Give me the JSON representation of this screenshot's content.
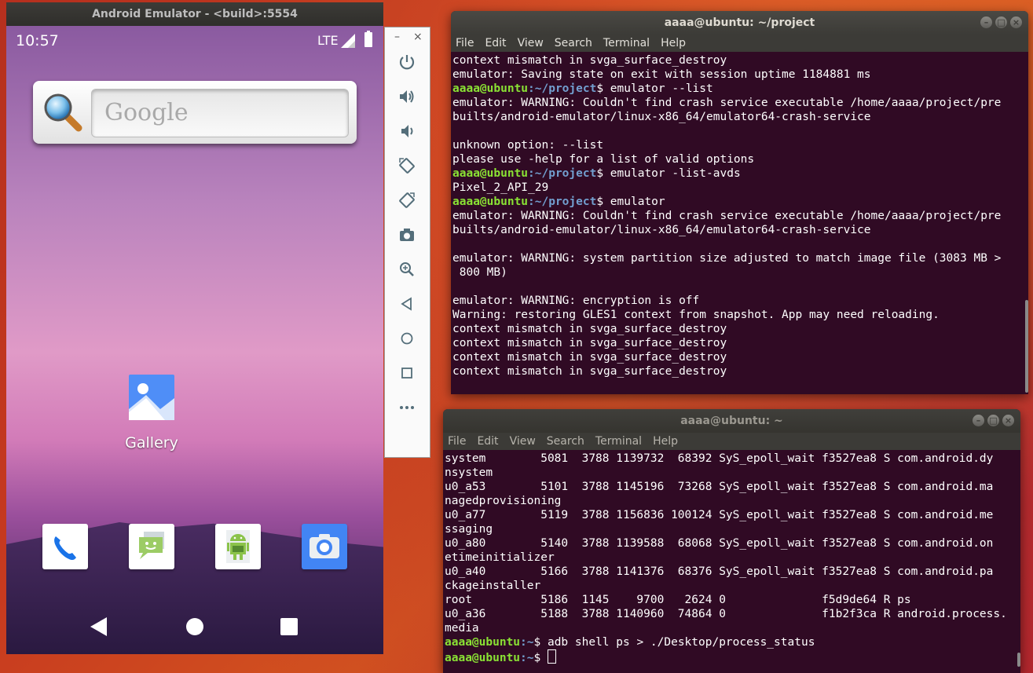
{
  "emulator": {
    "title": "Android Emulator - <build>:5554",
    "status": {
      "time": "10:57",
      "network": "LTE"
    },
    "search_widget": {
      "placeholder_text": "Google"
    },
    "home_apps": [
      {
        "label": "Gallery",
        "icon": "gallery-icon"
      }
    ],
    "dock": [
      {
        "name": "phone",
        "icon": "phone-icon"
      },
      {
        "name": "messages",
        "icon": "messages-icon"
      },
      {
        "name": "android-app",
        "icon": "android-robot-icon"
      },
      {
        "name": "camera",
        "icon": "camera-icon"
      }
    ],
    "toolbar": {
      "minimize_label": "–",
      "close_label": "×",
      "buttons": [
        "power-icon",
        "volume-up-icon",
        "volume-down-icon",
        "rotate-left-icon",
        "rotate-right-icon",
        "screenshot-icon",
        "zoom-icon",
        "back-icon",
        "home-icon",
        "overview-icon",
        "more-icon"
      ]
    }
  },
  "terminal_1": {
    "title": "aaaa@ubuntu: ~/project",
    "menu": [
      "File",
      "Edit",
      "View",
      "Search",
      "Terminal",
      "Help"
    ],
    "prompt_user": "aaaa@ubuntu",
    "prompt_path": ":~/project",
    "lines": [
      {
        "text": "context mismatch in svga_surface_destroy"
      },
      {
        "text": "emulator: Saving state on exit with session uptime 1184881 ms"
      },
      {
        "prompt": true,
        "cmd": "$ emulator --list"
      },
      {
        "text": "emulator: WARNING: Couldn't find crash service executable /home/aaaa/project/pre"
      },
      {
        "text": "builts/android-emulator/linux-x86_64/emulator64-crash-service"
      },
      {
        "text": ""
      },
      {
        "text": "unknown option: --list"
      },
      {
        "text": "please use -help for a list of valid options"
      },
      {
        "prompt": true,
        "cmd": "$ emulator -list-avds"
      },
      {
        "text": "Pixel_2_API_29"
      },
      {
        "prompt": true,
        "cmd": "$ emulator"
      },
      {
        "text": "emulator: WARNING: Couldn't find crash service executable /home/aaaa/project/pre"
      },
      {
        "text": "builts/android-emulator/linux-x86_64/emulator64-crash-service"
      },
      {
        "text": ""
      },
      {
        "text": "emulator: WARNING: system partition size adjusted to match image file (3083 MB >"
      },
      {
        "text": " 800 MB)"
      },
      {
        "text": ""
      },
      {
        "text": "emulator: WARNING: encryption is off"
      },
      {
        "text": "Warning: restoring GLES1 context from snapshot. App may need reloading."
      },
      {
        "text": "context mismatch in svga_surface_destroy"
      },
      {
        "text": "context mismatch in svga_surface_destroy"
      },
      {
        "text": "context mismatch in svga_surface_destroy"
      },
      {
        "text": "context mismatch in svga_surface_destroy"
      }
    ]
  },
  "terminal_2": {
    "title": "aaaa@ubuntu: ~",
    "menu": [
      "File",
      "Edit",
      "View",
      "Search",
      "Terminal",
      "Help"
    ],
    "prompt_user": "aaaa@ubuntu",
    "prompt_path": ":~",
    "lines": [
      {
        "text": "system        5081  3788 1139732  68392 SyS_epoll_wait f3527ea8 S com.android.dy"
      },
      {
        "text": "nsystem"
      },
      {
        "text": "u0_a53        5101  3788 1145196  73268 SyS_epoll_wait f3527ea8 S com.android.ma"
      },
      {
        "text": "nagedprovisioning"
      },
      {
        "text": "u0_a77        5119  3788 1156836 100124 SyS_epoll_wait f3527ea8 S com.android.me"
      },
      {
        "text": "ssaging"
      },
      {
        "text": "u0_a80        5140  3788 1139588  68068 SyS_epoll_wait f3527ea8 S com.android.on"
      },
      {
        "text": "etimeinitializer"
      },
      {
        "text": "u0_a40        5166  3788 1141376  68376 SyS_epoll_wait f3527ea8 S com.android.pa"
      },
      {
        "text": "ckageinstaller"
      },
      {
        "text": "root          5186  1145    9700   2624 0              f5d9de64 R ps"
      },
      {
        "text": "u0_a36        5188  3788 1140960  74864 0              f1b2f3ca R android.process."
      },
      {
        "text": "media"
      },
      {
        "prompt": true,
        "cmd": "$ adb shell ps > ./Desktop/process_status"
      },
      {
        "prompt": true,
        "cmd": "$ ",
        "cursor": true
      }
    ]
  }
}
